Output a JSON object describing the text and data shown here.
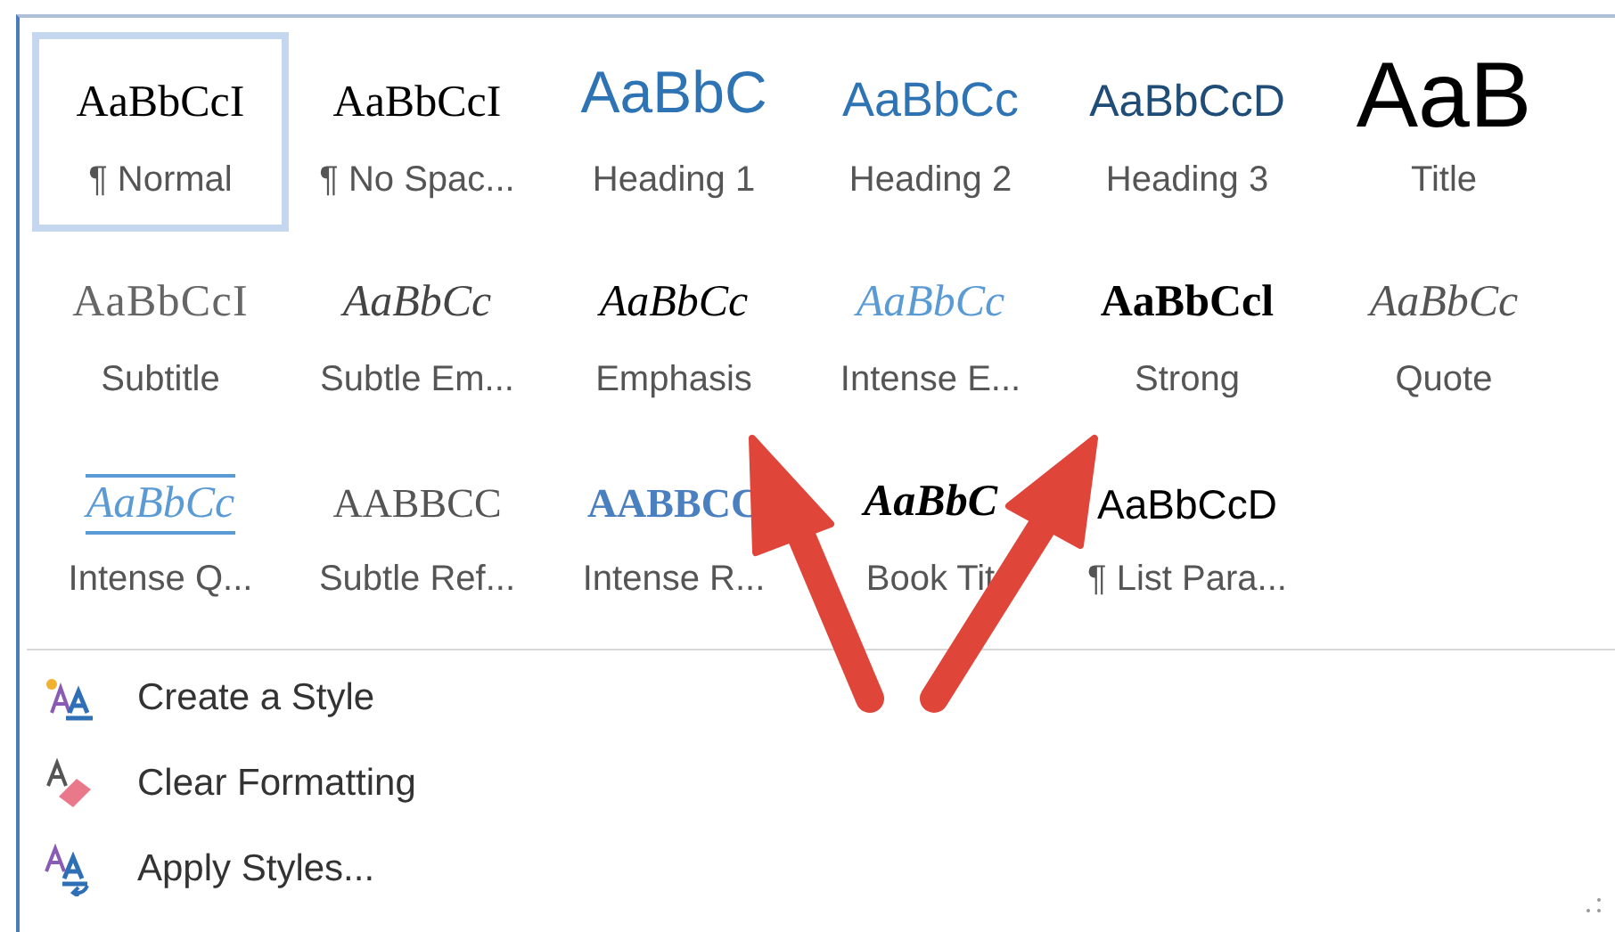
{
  "styles": [
    {
      "preview": "AaBbCcI",
      "name": "¶ Normal",
      "kind": "normal",
      "selected": true
    },
    {
      "preview": "AaBbCcI",
      "name": "¶ No Spac...",
      "kind": "normal",
      "selected": false
    },
    {
      "preview": "AaBbC",
      "name": "Heading 1",
      "kind": "heading1",
      "selected": false
    },
    {
      "preview": "AaBbCc",
      "name": "Heading 2",
      "kind": "heading2",
      "selected": false
    },
    {
      "preview": "AaBbCcD",
      "name": "Heading 3",
      "kind": "heading3",
      "selected": false
    },
    {
      "preview": "AaB",
      "name": "Title",
      "kind": "title",
      "selected": false
    },
    {
      "preview": "AaBbCcI",
      "name": "Subtitle",
      "kind": "subtitle",
      "selected": false
    },
    {
      "preview": "AaBbCc",
      "name": "Subtle Em...",
      "kind": "subtle_emphasis",
      "selected": false
    },
    {
      "preview": "AaBbCc",
      "name": "Emphasis",
      "kind": "emphasis",
      "selected": false
    },
    {
      "preview": "AaBbCc",
      "name": "Intense E...",
      "kind": "intense_emphasis",
      "selected": false
    },
    {
      "preview": "AaBbCcl",
      "name": "Strong",
      "kind": "strong",
      "selected": false
    },
    {
      "preview": "AaBbCc",
      "name": "Quote",
      "kind": "quote",
      "selected": false
    },
    {
      "preview": "AaBbCc",
      "name": "Intense Q...",
      "kind": "intense_quote",
      "selected": false
    },
    {
      "preview": "AABBCC",
      "name": "Subtle Ref...",
      "kind": "subtle_reference",
      "selected": false
    },
    {
      "preview": "AABBCC",
      "name": "Intense R...",
      "kind": "intense_reference",
      "selected": false
    },
    {
      "preview": "AaBbC",
      "name": "Book Tit",
      "kind": "book_title",
      "selected": false
    },
    {
      "preview": "AaBbCcD",
      "name": "¶ List Para...",
      "kind": "list_paragraph",
      "selected": false
    }
  ],
  "menu": [
    {
      "label": "Create a Style",
      "kind": "create"
    },
    {
      "label": "Clear Formatting",
      "kind": "clear"
    },
    {
      "label": "Apply Styles...",
      "kind": "apply"
    }
  ]
}
